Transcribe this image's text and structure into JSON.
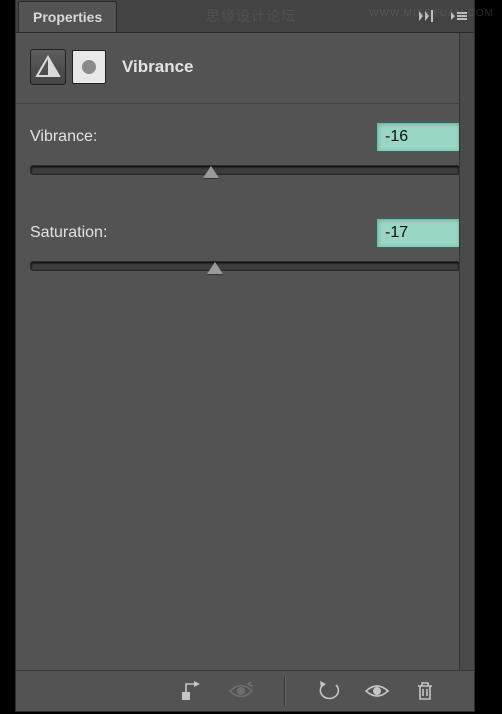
{
  "panel": {
    "title": "Properties"
  },
  "adjustment": {
    "name": "Vibrance"
  },
  "controls": [
    {
      "label": "Vibrance:",
      "value": "-16",
      "thumbPercent": 42
    },
    {
      "label": "Saturation:",
      "value": "-17",
      "thumbPercent": 43
    }
  ],
  "watermarks": {
    "center": "思缘设计论坛",
    "right": "WWW.MISSYUAN.COM"
  }
}
